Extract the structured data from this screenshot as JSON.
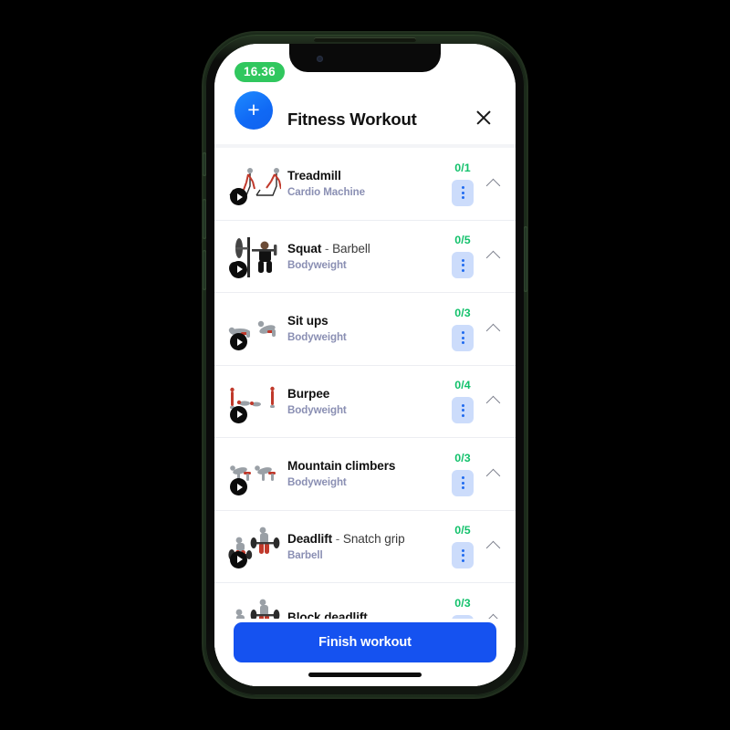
{
  "device": {
    "status_time": "16.36",
    "home_indicator": true
  },
  "header": {
    "add_label": "+",
    "title": "Fitness Workout",
    "close_label": "close-icon"
  },
  "colors": {
    "accent_blue": "#1552f0",
    "add_button_blue": "#1069f5",
    "sets_green": "#12c16b",
    "status_pill_green": "#30c75e",
    "subtitle_purple": "#8a8fb3",
    "kebab_bg": "#ccdcfb",
    "kebab_dot": "#1f6af0"
  },
  "exercises": [
    {
      "name": "Treadmill",
      "variant": "",
      "equipment": "Cardio Machine",
      "sets": "0/1",
      "thumb": "treadmill-thumbnail",
      "menu": "kebab-menu-icon",
      "collapse": "chevron-up-icon",
      "play": "play-icon"
    },
    {
      "name": "Squat",
      "variant": "Barbell",
      "equipment": "Bodyweight",
      "sets": "0/5",
      "thumb": "squat-barbell-thumbnail",
      "menu": "kebab-menu-icon",
      "collapse": "chevron-up-icon",
      "play": "play-icon"
    },
    {
      "name": "Sit ups",
      "variant": "",
      "equipment": "Bodyweight",
      "sets": "0/3",
      "thumb": "situps-thumbnail",
      "menu": "kebab-menu-icon",
      "collapse": "chevron-up-icon",
      "play": "play-icon"
    },
    {
      "name": "Burpee",
      "variant": "",
      "equipment": "Bodyweight",
      "sets": "0/4",
      "thumb": "burpee-thumbnail",
      "menu": "kebab-menu-icon",
      "collapse": "chevron-up-icon",
      "play": "play-icon"
    },
    {
      "name": "Mountain climbers",
      "variant": "",
      "equipment": "Bodyweight",
      "sets": "0/3",
      "thumb": "mountain-climbers-thumbnail",
      "menu": "kebab-menu-icon",
      "collapse": "chevron-up-icon",
      "play": "play-icon"
    },
    {
      "name": "Deadlift",
      "variant": "Snatch grip",
      "equipment": "Barbell",
      "sets": "0/5",
      "thumb": "deadlift-snatch-grip-thumbnail",
      "menu": "kebab-menu-icon",
      "collapse": "chevron-up-icon",
      "play": "play-icon"
    },
    {
      "name": "Block deadlift",
      "variant": "",
      "equipment": "",
      "sets": "0/3",
      "thumb": "block-deadlift-thumbnail",
      "menu": "kebab-menu-icon",
      "collapse": "chevron-up-icon",
      "play": "play-icon",
      "partially_visible": true
    }
  ],
  "footer": {
    "finish_label": "Finish workout"
  }
}
